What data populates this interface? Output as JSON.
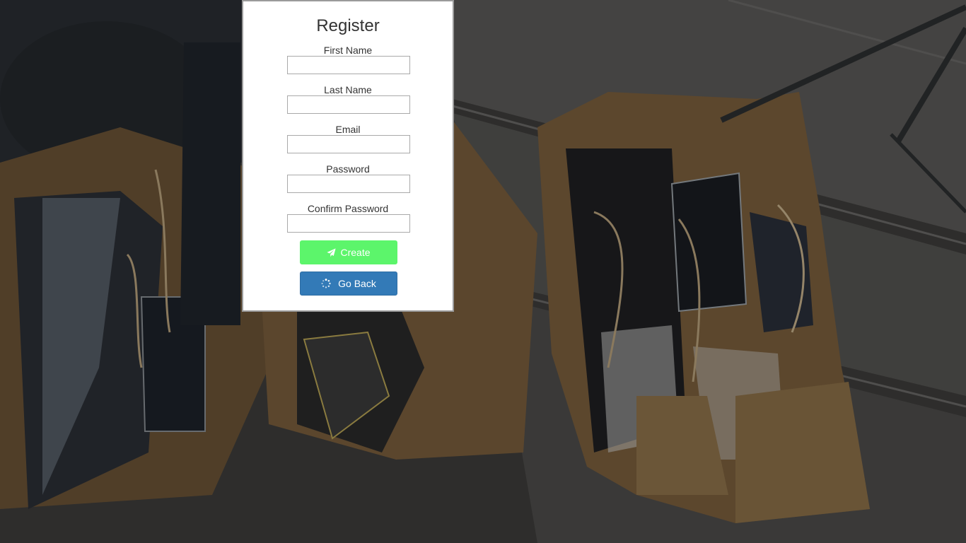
{
  "form": {
    "title": "Register",
    "fields": [
      {
        "label": "First Name",
        "value": ""
      },
      {
        "label": "Last Name",
        "value": ""
      },
      {
        "label": "Email",
        "value": ""
      },
      {
        "label": "Password",
        "value": ""
      },
      {
        "label": "Confirm Password",
        "value": ""
      }
    ],
    "create_label": "Create",
    "create_icon": "paper-plane-icon",
    "back_label": "Go Back",
    "back_icon": "spinner-icon"
  },
  "colors": {
    "create_button": "#5cf56b",
    "back_button": "#337ab7",
    "panel_border": "#9a9a9a"
  }
}
